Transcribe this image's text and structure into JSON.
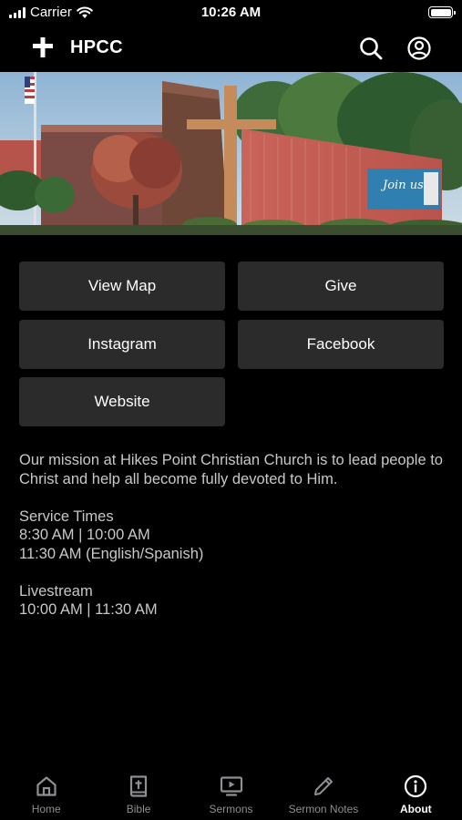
{
  "status_bar": {
    "carrier": "Carrier",
    "time": "10:26 AM"
  },
  "nav": {
    "title": "HPCC",
    "icons": [
      "cross-icon",
      "search-icon",
      "profile-icon"
    ]
  },
  "hero": {
    "banner_text": "Join us"
  },
  "buttons": {
    "view_map": "View Map",
    "give": "Give",
    "instagram": "Instagram",
    "facebook": "Facebook",
    "website": "Website"
  },
  "about": {
    "mission": "Our mission at Hikes Point Christian Church is to lead people to Christ and help all become fully devoted to Him.",
    "service_heading": "Service Times",
    "service_line1": "8:30 AM | 10:00 AM",
    "service_line2": "11:30 AM (English/Spanish)",
    "livestream_heading": "Livestream",
    "livestream_times": "10:00 AM | 11:30 AM"
  },
  "tabs": [
    {
      "label": "Home",
      "icon": "home-icon",
      "active": false
    },
    {
      "label": "Bible",
      "icon": "bible-icon",
      "active": false
    },
    {
      "label": "Sermons",
      "icon": "sermons-icon",
      "active": false
    },
    {
      "label": "Sermon Notes",
      "icon": "pencil-icon",
      "active": false
    },
    {
      "label": "About",
      "icon": "info-icon",
      "active": true
    }
  ],
  "colors": {
    "background": "#000000",
    "button_bg": "#2b2b2b",
    "text_secondary": "#c8c8c8",
    "tab_inactive": "#8e8e93",
    "tab_active": "#ffffff"
  }
}
